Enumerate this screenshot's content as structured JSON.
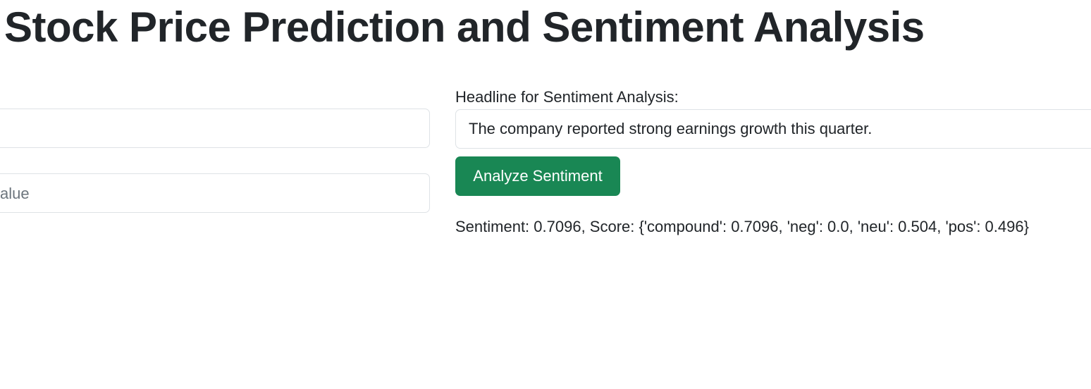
{
  "page": {
    "title": "Stock Price Prediction and Sentiment Analysis"
  },
  "prediction_form": {
    "field_1": {
      "value": "",
      "placeholder": ""
    },
    "field_2": {
      "value": "",
      "placeholder_visible_fragment": "alue"
    }
  },
  "sentiment_form": {
    "label": "Headline for Sentiment Analysis:",
    "headline_value": "The company reported strong earnings growth this quarter.",
    "button_label": "Analyze Sentiment",
    "result": "Sentiment: 0.7096, Score: {'compound': 0.7096, 'neg': 0.0, 'neu': 0.504, 'pos': 0.496}"
  },
  "colors": {
    "button_bg": "#198754",
    "text": "#212529",
    "input_border": "#dee2e6",
    "placeholder": "#6c757d"
  }
}
